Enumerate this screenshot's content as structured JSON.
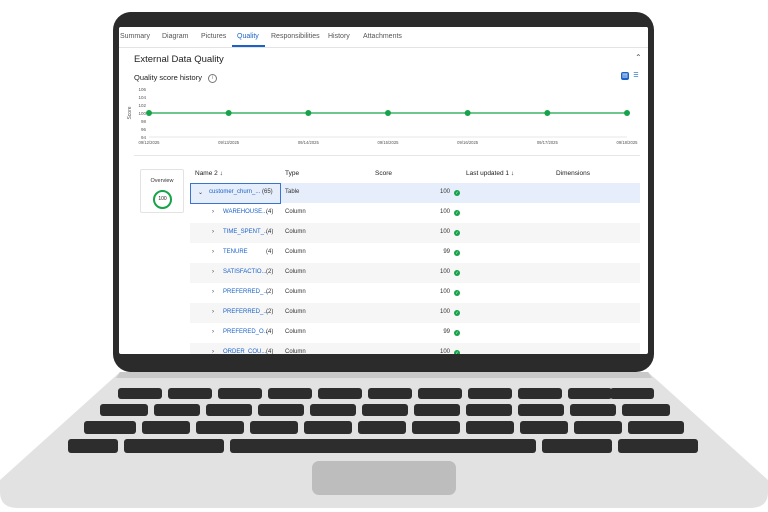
{
  "tabs": [
    {
      "label": "Summary",
      "active": false
    },
    {
      "label": "Diagram",
      "active": false
    },
    {
      "label": "Pictures",
      "active": false
    },
    {
      "label": "Quality",
      "active": true
    },
    {
      "label": "Responsibilities",
      "active": false
    },
    {
      "label": "History",
      "active": false
    },
    {
      "label": "Attachments",
      "active": false
    }
  ],
  "panel": {
    "title": "External Data Quality",
    "collapse_icon": "chevron-up-icon"
  },
  "quality_history": {
    "title": "Quality score history",
    "info_icon": "info-icon",
    "view_toggle": [
      "chart-view-icon",
      "list-view-icon"
    ]
  },
  "chart_data": {
    "type": "line",
    "ylabel": "Score",
    "ylim": [
      94,
      106
    ],
    "yticks": [
      "94",
      "96",
      "98",
      "100",
      "102",
      "104",
      "106"
    ],
    "x": [
      "09/12/2025",
      "09/13/2025",
      "09/14/2025",
      "09/15/2025",
      "09/16/2025",
      "09/17/2025",
      "09/18/2025"
    ],
    "values": [
      100,
      100,
      100,
      100,
      100,
      100,
      100
    ],
    "color": "#16a34a",
    "grid": false
  },
  "overview": {
    "label": "Overview",
    "score": "100"
  },
  "table": {
    "headers": {
      "name": "Name 2 ↓",
      "type": "Type",
      "score": "Score",
      "last_updated": "Last updated 1 ↓",
      "dimensions": "Dimensions"
    },
    "rows": [
      {
        "name": "customer_churn_...",
        "count": "(65)",
        "type": "Table",
        "score": "100",
        "expanded": true,
        "selected": true
      },
      {
        "name": "WAREHOUSE...",
        "count": "(4)",
        "type": "Column",
        "score": "100"
      },
      {
        "name": "TIME_SPENT_...",
        "count": "(4)",
        "type": "Column",
        "score": "100"
      },
      {
        "name": "TENURE",
        "count": "(4)",
        "type": "Column",
        "score": "99"
      },
      {
        "name": "SATISFACTIO...",
        "count": "(2)",
        "type": "Column",
        "score": "100"
      },
      {
        "name": "PREFERRED_...",
        "count": "(2)",
        "type": "Column",
        "score": "100"
      },
      {
        "name": "PREFERRED_...",
        "count": "(2)",
        "type": "Column",
        "score": "100"
      },
      {
        "name": "PREFERED_O...",
        "count": "(4)",
        "type": "Column",
        "score": "99"
      },
      {
        "name": "ORDER_COU...",
        "count": "(4)",
        "type": "Column",
        "score": "100"
      }
    ]
  }
}
